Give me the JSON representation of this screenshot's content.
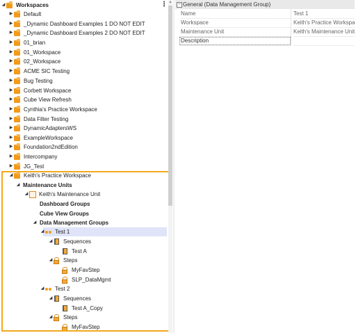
{
  "tree": {
    "root_label": "Workspaces",
    "menu_glyph": "⋮",
    "workspaces": [
      "Default",
      "_Dynamic Dashboard Examples 1 DO NOT EDIT",
      "_Dynamic Dashboard Examples 2 DO NOT EDIT",
      "01_brian",
      "01_Workspace",
      "02_Workspace",
      "ACME SIC Testing",
      "Bug Testing",
      "Corbett Workspace",
      "Cube View Refresh",
      "Cynthia's Practice Workspace",
      "Data Filter Testing",
      "DynamicAdaptersWS",
      "ExampleWorkspace",
      "Foundation2ndEdition",
      "Intercompany",
      "JG_Test"
    ],
    "expanded_workspace": "Keith's Practice Workspace",
    "maintenance_units_label": "Maintenance Units",
    "maintenance_unit": "Keith's Maintenance Unit",
    "dashboard_groups": "Dashboard Groups",
    "cube_view_groups": "Cube View Groups",
    "data_management_groups": "Data Management Groups",
    "test1": {
      "label": "Test 1",
      "sequences_label": "Sequences",
      "sequences": [
        "Test A"
      ],
      "steps_label": "Steps",
      "steps": [
        "MyFavStep",
        "SLP_DataMgmt"
      ]
    },
    "test2": {
      "label": "Test 2",
      "sequences_label": "Sequences",
      "sequences": [
        "Test A_Copy"
      ],
      "steps_label": "Steps",
      "steps": [
        "MyFavStep"
      ]
    }
  },
  "properties": {
    "toggle_glyph": "−",
    "header": "General (Data Management Group)",
    "rows": [
      {
        "name": "Name",
        "value": "Test 1"
      },
      {
        "name": "Workspace",
        "value": "Keith's Practice Workspace"
      },
      {
        "name": "Maintenance Unit",
        "value": "Keith's Maintenance Unit"
      },
      {
        "name": "Description",
        "value": ""
      }
    ]
  }
}
